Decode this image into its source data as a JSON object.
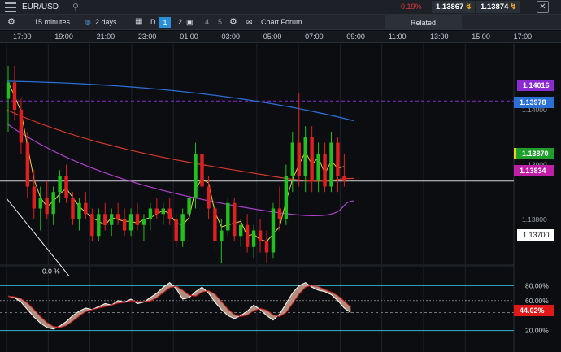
{
  "topbar": {
    "symbol": "EUR/USD",
    "change": "-0.19%",
    "bid": "1.13867",
    "ask": "1.13874",
    "menu_icon": "hamburger-icon",
    "search_icon": "search-icon",
    "close_icon": "close-icon"
  },
  "toolbar": {
    "interval": "15 minutes",
    "range": "2 days",
    "chart_type_d": "D",
    "layout_1": "1",
    "layout_2": "2",
    "layout_4": "4",
    "layout_5": "5",
    "chart_forum": "Chart Forum",
    "related": "Related"
  },
  "time_labels": [
    "17:00",
    "19:00",
    "21:00",
    "23:00",
    "01:00",
    "03:00",
    "05:00",
    "07:00",
    "09:00",
    "11:00",
    "13:00",
    "15:00",
    "17:00"
  ],
  "price_tags": {
    "purple": "1.14016",
    "blue": "1.13978",
    "green": "1.13870",
    "magenta": "1.13834",
    "white": "1.13700"
  },
  "price_axis": [
    "1.14000",
    "1.13900",
    "1.13800"
  ],
  "fib_label": "0.0 %",
  "oscillator": {
    "levels": [
      "80.00%",
      "60.00%",
      "20.00%"
    ],
    "current": "44.02%"
  },
  "colors": {
    "up": "#20c020",
    "down": "#e02020",
    "blue_ma": "#2a6fd8",
    "red_ma": "#d83a2a",
    "purple_ma": "#b040d0",
    "yellow_ma": "#e8d040",
    "cyan_level": "#30b8c8"
  },
  "chart_data": {
    "type": "candlestick",
    "x": [
      "17:00",
      "19:00",
      "21:00",
      "23:00",
      "01:00",
      "03:00",
      "05:00",
      "07:00",
      "09:00"
    ],
    "ylim": [
      1.1372,
      1.1412
    ],
    "ohlc": [
      [
        1.1402,
        1.1408,
        1.1396,
        1.1405
      ],
      [
        1.1405,
        1.1408,
        1.1398,
        1.14
      ],
      [
        1.14,
        1.1402,
        1.1392,
        1.1394
      ],
      [
        1.1394,
        1.1396,
        1.1384,
        1.1386
      ],
      [
        1.1386,
        1.1389,
        1.138,
        1.1382
      ],
      [
        1.1382,
        1.1386,
        1.1378,
        1.1384
      ],
      [
        1.1384,
        1.1387,
        1.138,
        1.1381
      ],
      [
        1.1381,
        1.1386,
        1.1379,
        1.1385
      ],
      [
        1.1385,
        1.1389,
        1.1383,
        1.1388
      ],
      [
        1.1388,
        1.139,
        1.1383,
        1.1384
      ],
      [
        1.1384,
        1.1385,
        1.1379,
        1.138
      ],
      [
        1.138,
        1.1384,
        1.1378,
        1.1383
      ],
      [
        1.1383,
        1.1385,
        1.138,
        1.1381
      ],
      [
        1.1381,
        1.1382,
        1.1376,
        1.1377
      ],
      [
        1.1377,
        1.1382,
        1.1376,
        1.1381
      ],
      [
        1.1381,
        1.1383,
        1.1378,
        1.1379
      ],
      [
        1.1379,
        1.1382,
        1.1377,
        1.1381
      ],
      [
        1.1381,
        1.1383,
        1.1379,
        1.138
      ],
      [
        1.138,
        1.1382,
        1.1377,
        1.1378
      ],
      [
        1.1378,
        1.1382,
        1.1377,
        1.1381
      ],
      [
        1.1381,
        1.1383,
        1.1378,
        1.1379
      ],
      [
        1.1379,
        1.1381,
        1.1376,
        1.138
      ],
      [
        1.138,
        1.1383,
        1.1378,
        1.1382
      ],
      [
        1.1382,
        1.1384,
        1.138,
        1.1381
      ],
      [
        1.1381,
        1.1383,
        1.1379,
        1.1382
      ],
      [
        1.1382,
        1.1384,
        1.1379,
        1.138
      ],
      [
        1.138,
        1.1381,
        1.1375,
        1.1376
      ],
      [
        1.1376,
        1.1382,
        1.1375,
        1.1381
      ],
      [
        1.1381,
        1.1385,
        1.138,
        1.1384
      ],
      [
        1.1384,
        1.1394,
        1.1382,
        1.1392
      ],
      [
        1.1392,
        1.1394,
        1.1384,
        1.1386
      ],
      [
        1.1386,
        1.1388,
        1.138,
        1.1382
      ],
      [
        1.1382,
        1.1384,
        1.1374,
        1.1376
      ],
      [
        1.1376,
        1.138,
        1.1372,
        1.1378
      ],
      [
        1.1378,
        1.1384,
        1.1377,
        1.1383
      ],
      [
        1.1383,
        1.1384,
        1.1376,
        1.1377
      ],
      [
        1.1377,
        1.138,
        1.1375,
        1.1379
      ],
      [
        1.1379,
        1.1381,
        1.1374,
        1.1375
      ],
      [
        1.1375,
        1.1379,
        1.1373,
        1.1378
      ],
      [
        1.1378,
        1.138,
        1.1374,
        1.1376
      ],
      [
        1.1376,
        1.1378,
        1.1372,
        1.1374
      ],
      [
        1.1374,
        1.1383,
        1.1373,
        1.1382
      ],
      [
        1.1382,
        1.1386,
        1.1378,
        1.138
      ],
      [
        1.138,
        1.139,
        1.1379,
        1.1388
      ],
      [
        1.1388,
        1.1396,
        1.1385,
        1.1394
      ],
      [
        1.1394,
        1.1403,
        1.1386,
        1.1388
      ],
      [
        1.1388,
        1.1397,
        1.1385,
        1.1395
      ],
      [
        1.1395,
        1.1397,
        1.1385,
        1.1387
      ],
      [
        1.1387,
        1.1394,
        1.1385,
        1.1392
      ],
      [
        1.1392,
        1.1394,
        1.1385,
        1.1386
      ],
      [
        1.1386,
        1.1396,
        1.1385,
        1.1394
      ],
      [
        1.1394,
        1.1395,
        1.1385,
        1.1388
      ],
      [
        1.1388,
        1.1392,
        1.1386,
        1.1387
      ]
    ],
    "oscillator_values": [
      66,
      64,
      58,
      48,
      38,
      30,
      24,
      22,
      26,
      32,
      40,
      46,
      50,
      48,
      52,
      56,
      54,
      60,
      58,
      62,
      56,
      58,
      64,
      70,
      78,
      84,
      76,
      62,
      64,
      72,
      78,
      70,
      58,
      48,
      40,
      36,
      40,
      46,
      54,
      48,
      40,
      34,
      42,
      56,
      70,
      80,
      84,
      78,
      74,
      72,
      68,
      60,
      50,
      44
    ]
  }
}
